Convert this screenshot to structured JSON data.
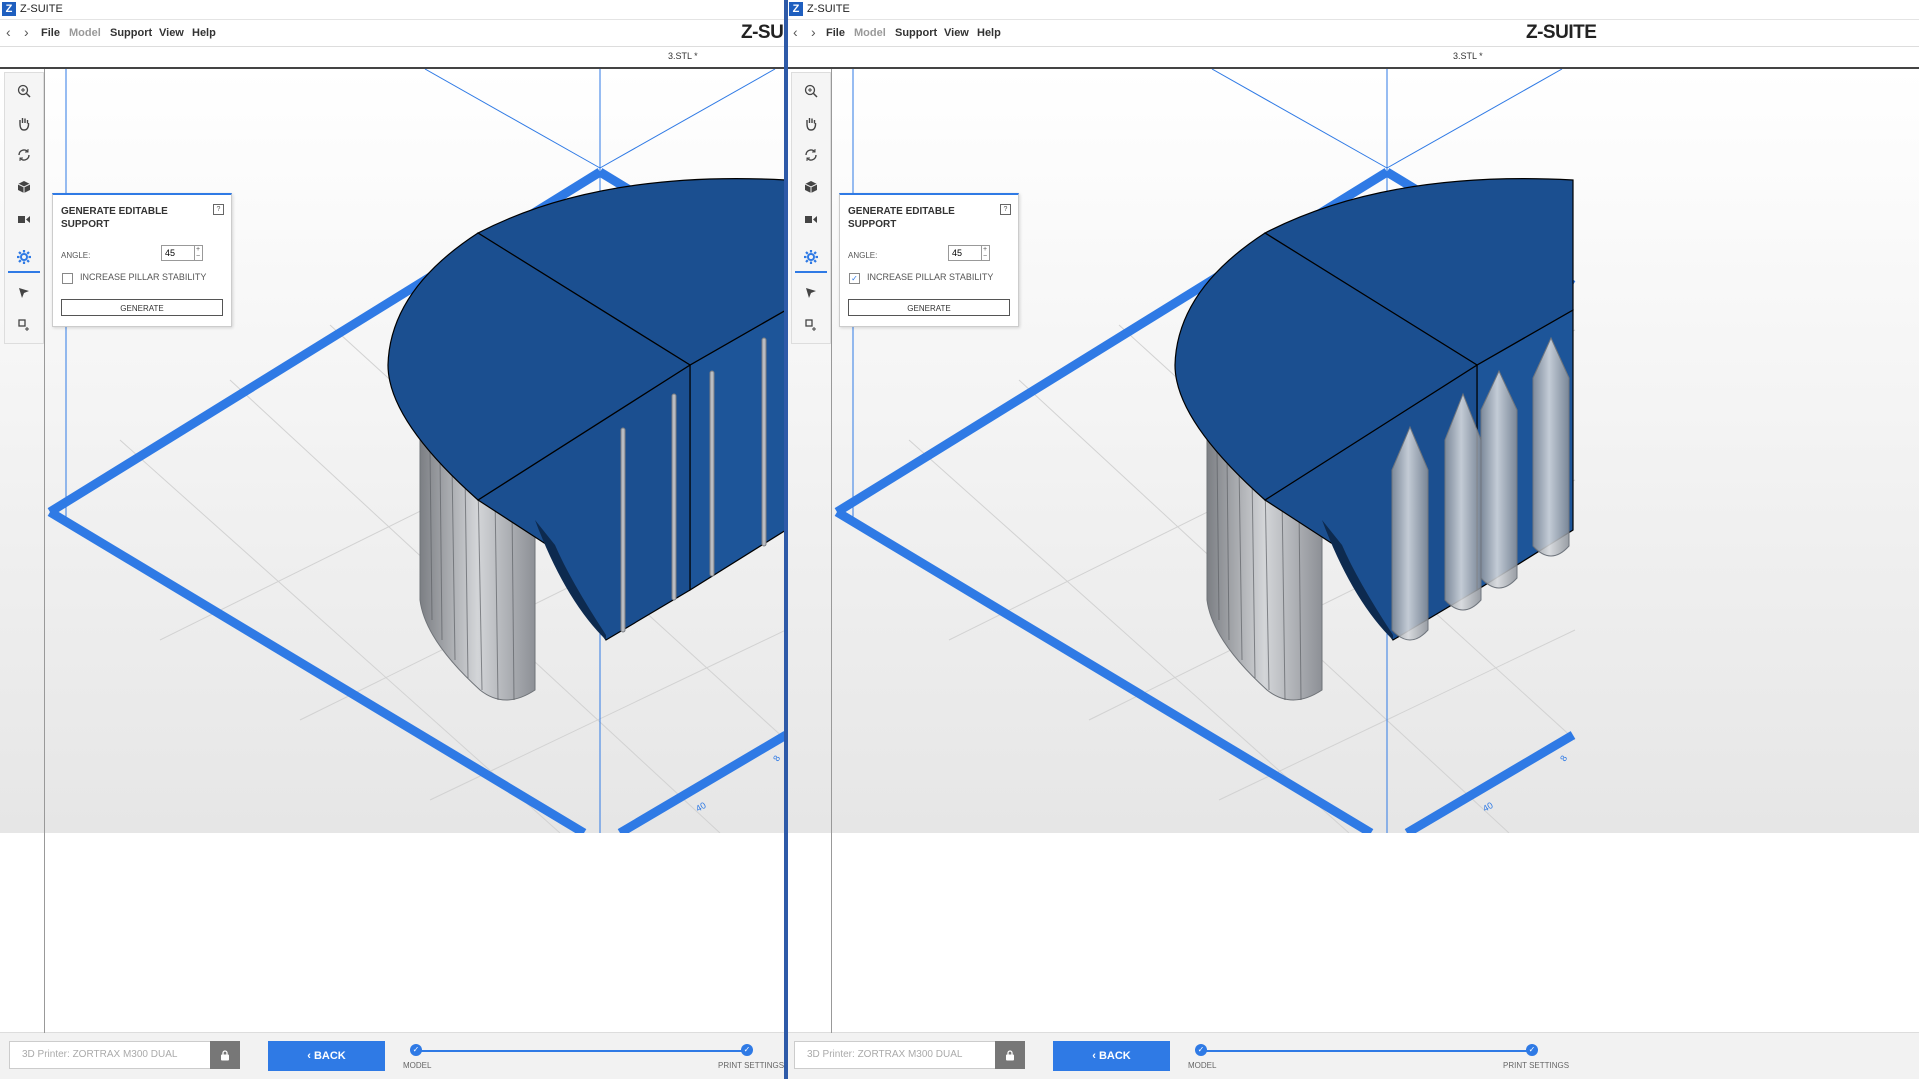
{
  "app": {
    "logo_letter": "Z",
    "title": "Z-SUITE",
    "brand": "Z-SUITE"
  },
  "menu": {
    "back_arrow": "‹",
    "forward_arrow": "›",
    "items": [
      "File",
      "Model",
      "Support",
      "View",
      "Help"
    ]
  },
  "file_tab": "3.STL *",
  "tools": [
    "zoom-icon",
    "hand-pan-icon",
    "rotate-icon",
    "cube-view-icon",
    "move-object-icon",
    "support-gear-icon",
    "select-arrow-icon",
    "add-support-icon"
  ],
  "panel": {
    "title": "GENERATE EDITABLE SUPPORT",
    "help": "?",
    "angle_label": "ANGLE:",
    "angle_value": "45",
    "stepper_up": "+",
    "stepper_down": "−",
    "checkbox_label": "INCREASE PILLAR STABILITY",
    "generate_label": "GENERATE"
  },
  "viewport": {
    "grid_label": "40",
    "grid_label_right_edge": "8"
  },
  "states": {
    "left": {
      "pillar_stability_checked": false
    },
    "right": {
      "pillar_stability_checked": true
    }
  },
  "bottom": {
    "printer_label": "3D Printer:",
    "printer_name": "ZORTRAX M300 DUAL",
    "back_label": "BACK",
    "steps": [
      "MODEL",
      "PRINT SETTINGS"
    ]
  },
  "colors": {
    "accent": "#2f7ae5",
    "model": "#1b4f90",
    "support_gray": "#9aa0a8",
    "divider": "#2e5aa8"
  }
}
